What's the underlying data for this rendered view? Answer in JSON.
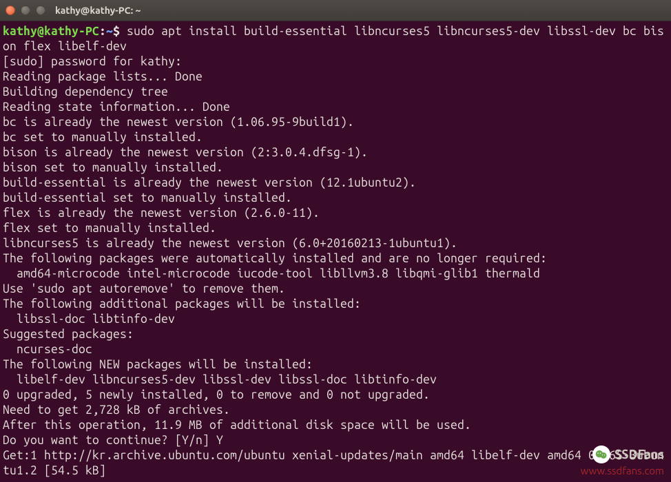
{
  "titlebar": {
    "title": "kathy@kathy-PC: ~"
  },
  "prompt": {
    "user": "kathy",
    "at": "@",
    "host": "kathy-PC",
    "colon": ":",
    "path": "~",
    "dollar": "$"
  },
  "command": "sudo apt install build-essential libncurses5 libncurses5-dev libssl-dev bc bison flex libelf-dev",
  "output": [
    "[sudo] password for kathy:",
    "Reading package lists... Done",
    "Building dependency tree",
    "Reading state information... Done",
    "bc is already the newest version (1.06.95-9build1).",
    "bc set to manually installed.",
    "bison is already the newest version (2:3.0.4.dfsg-1).",
    "bison set to manually installed.",
    "build-essential is already the newest version (12.1ubuntu2).",
    "build-essential set to manually installed.",
    "flex is already the newest version (2.6.0-11).",
    "flex set to manually installed.",
    "libncurses5 is already the newest version (6.0+20160213-1ubuntu1).",
    "The following packages were automatically installed and are no longer required:",
    "  amd64-microcode intel-microcode iucode-tool libllvm3.8 libqmi-glib1 thermald",
    "Use 'sudo apt autoremove' to remove them.",
    "The following additional packages will be installed:",
    "  libssl-doc libtinfo-dev",
    "Suggested packages:",
    "  ncurses-doc",
    "The following NEW packages will be installed:",
    "  libelf-dev libncurses5-dev libssl-dev libssl-doc libtinfo-dev",
    "0 upgraded, 5 newly installed, 0 to remove and 0 not upgraded.",
    "Need to get 2,728 kB of archives.",
    "After this operation, 11.9 MB of additional disk space will be used.",
    "Do you want to continue? [Y/n] Y",
    "Get:1 http://kr.archive.ubuntu.com/ubuntu xenial-updates/main amd64 libelf-dev amd64 0.165-3ubuntu1.2 [54.5 kB]"
  ],
  "watermark": {
    "label": "SSDFans",
    "url": "www.ssdfans.com"
  }
}
